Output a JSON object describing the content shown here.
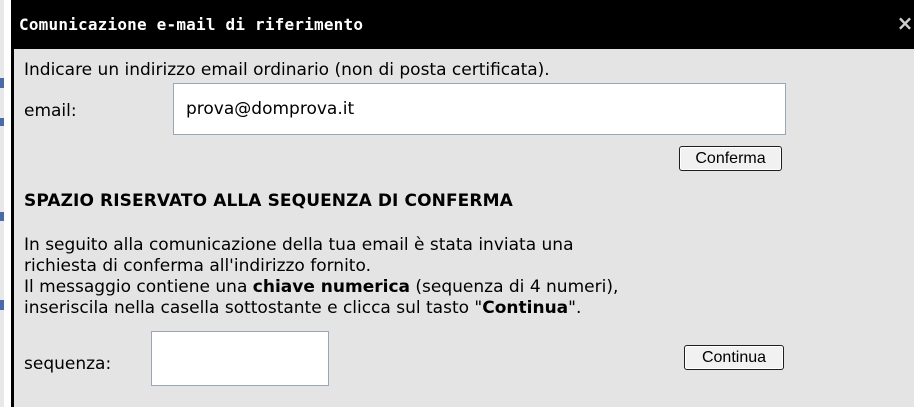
{
  "dialog": {
    "title": "Comunicazione e-mail di riferimento",
    "close_glyph": "×"
  },
  "email_section": {
    "intro": "Indicare un indirizzo email ordinario (non di posta certificata).",
    "label": "email:",
    "value": "prova@domprova.it",
    "button_label": "Conferma"
  },
  "confirm_section": {
    "title": "SPAZIO RISERVATO ALLA SEQUENZA DI CONFERMA",
    "paragraph": {
      "line1": "In seguito alla comunicazione della tua email è stata inviata una",
      "line2": "richiesta di conferma all'indirizzo fornito.",
      "line3_prefix": "Il messaggio contiene una ",
      "line3_bold": "chiave numerica",
      "line3_suffix": " (sequenza di 4 numeri),",
      "line4_prefix": "inseriscila nella casella sottostante e clicca sul tasto \"",
      "line4_bold": "Continua",
      "line4_suffix": "\"."
    },
    "sequence_label": "sequenza:",
    "sequence_value": "",
    "button_label": "Continua"
  },
  "colors": {
    "title_bar": "#000000",
    "dialog_bg": "#e4e4e4",
    "page_edge_accent": "#4a6aa8"
  }
}
